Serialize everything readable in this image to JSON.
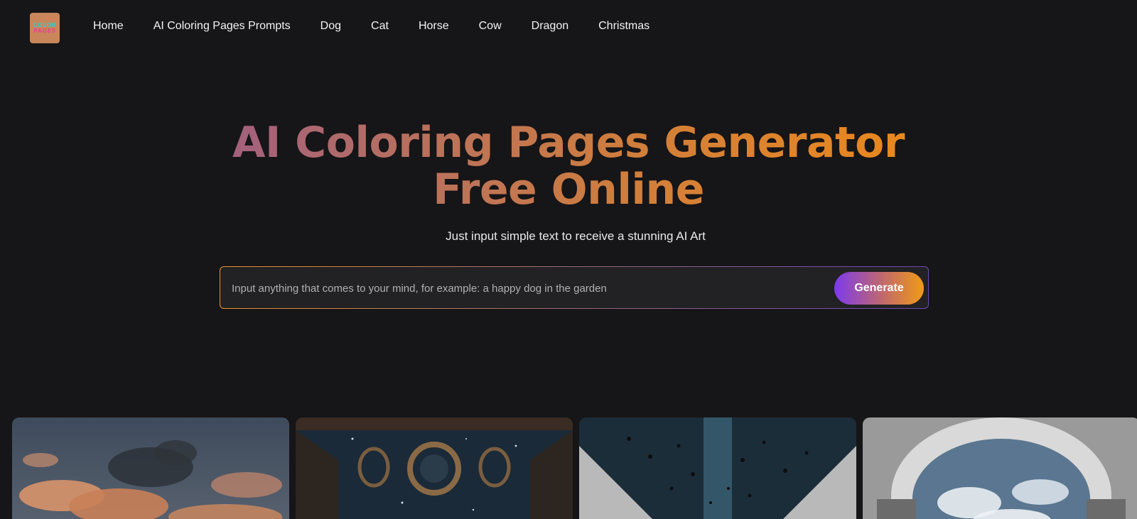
{
  "nav": {
    "logo_top": "COLOR",
    "logo_bottom": "PAGES",
    "links": [
      "Home",
      "AI Coloring Pages Prompts",
      "Dog",
      "Cat",
      "Horse",
      "Cow",
      "Dragon",
      "Christmas"
    ]
  },
  "hero": {
    "title": "AI Coloring Pages Generator Free Online",
    "subtitle": "Just input simple text to receive a stunning AI Art"
  },
  "search": {
    "placeholder": "Input anything that comes to your mind, for example: a happy dog in the garden",
    "value": "",
    "button_label": "Generate"
  },
  "gallery": {
    "images": [
      {
        "subject": "sunset-clouds-sky"
      },
      {
        "subject": "ornate-ceiling-starry-sky"
      },
      {
        "subject": "music-notes-corridor"
      },
      {
        "subject": "stone-arch-cloudy-sky"
      }
    ]
  },
  "colors": {
    "background": "#161517",
    "title_gradient_start": "#9c5c86",
    "title_gradient_end": "#ef8a18",
    "button_gradient_start": "#7c3aed",
    "button_gradient_end": "#f09a16"
  }
}
